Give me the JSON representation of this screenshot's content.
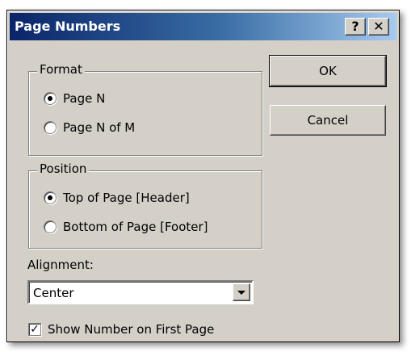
{
  "dialog": {
    "title": "Page Numbers",
    "help_glyph": "?",
    "close_glyph": "✕"
  },
  "format_group": {
    "label": "Format",
    "options": [
      {
        "label": "Page N",
        "checked": true
      },
      {
        "label": "Page N of M",
        "checked": false
      }
    ]
  },
  "position_group": {
    "label": "Position",
    "options": [
      {
        "label": "Top of Page [Header]",
        "checked": true
      },
      {
        "label": "Bottom of Page [Footer]",
        "checked": false
      }
    ]
  },
  "alignment": {
    "label": "Alignment:",
    "selected": "Center"
  },
  "show_first_page": {
    "label": "Show Number on First Page",
    "checked": true,
    "check_glyph": "✓"
  },
  "buttons": {
    "ok": "OK",
    "cancel": "Cancel"
  },
  "colors": {
    "face": "#d4d0c8",
    "title_start": "#0a246a",
    "title_end": "#a6caf0"
  }
}
